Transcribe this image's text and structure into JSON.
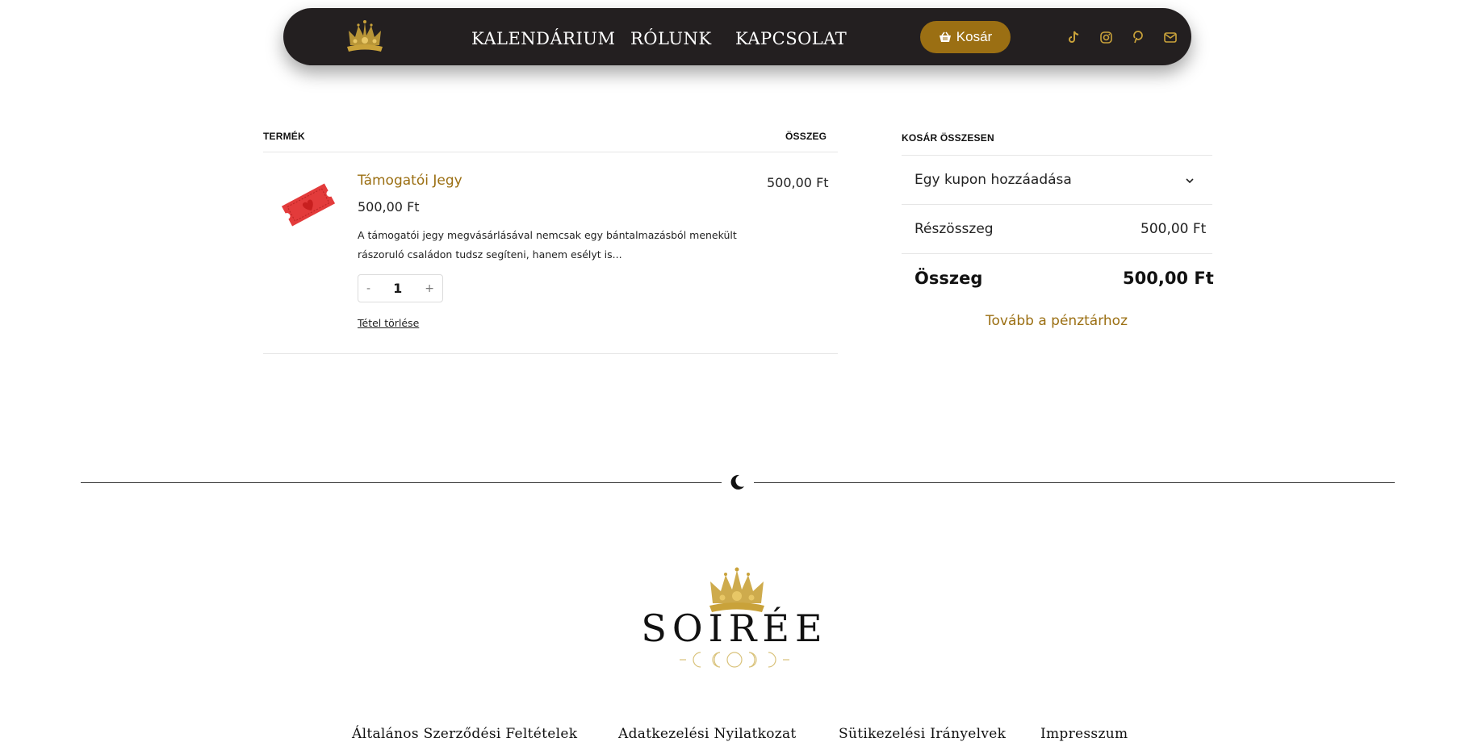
{
  "header": {
    "nav": [
      "KALENDÁRIUM",
      "RÓLUNK",
      "KAPCSOLAT"
    ],
    "cart_label": "Kosár",
    "social_icons": [
      "tiktok-icon",
      "instagram-icon",
      "pinterest-icon",
      "email-icon"
    ]
  },
  "cart": {
    "col_product": "TERMÉK",
    "col_total": "ÖSSZEG",
    "item": {
      "name": "Támogatói Jegy",
      "price": "500,00 Ft",
      "description": "A támogatói jegy megvásárlásával nemcsak egy bántalmazásból menekült rászoruló családon tudsz segíteni, hanem esélyt is...",
      "quantity": "1",
      "minus": "-",
      "plus": "+",
      "remove_label": "Tétel törlése",
      "line_total": "500,00 Ft"
    }
  },
  "totals": {
    "heading": "KOSÁR ÖSSZESEN",
    "coupon_label": "Egy kupon hozzáadása",
    "subtotal_label": "Részösszeg",
    "subtotal_value": "500,00 Ft",
    "total_label": "Összeg",
    "total_value": "500,00 Ft",
    "checkout_label": "Tovább a pénztárhoz"
  },
  "footer": {
    "brand": "SOIRÉE",
    "links": [
      "Általános Szerződési Feltételek",
      "Adatkezelési Nyilatkozat",
      "Sütikezelési Irányelvek",
      "Impresszum"
    ]
  },
  "colors": {
    "header_bg": "#231f20",
    "accent_gold": "#9b6f13",
    "icon_gold": "#c9a23a"
  }
}
